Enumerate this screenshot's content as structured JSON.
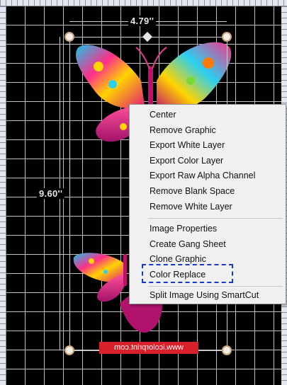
{
  "canvas": {
    "width_label": "4.79''",
    "height_label": "9.60''",
    "watermark": "www.icolorprint.com"
  },
  "context_menu": {
    "group1": [
      {
        "id": "center",
        "label": "Center"
      },
      {
        "id": "remove-graphic",
        "label": "Remove Graphic"
      },
      {
        "id": "export-white-layer",
        "label": "Export White Layer"
      },
      {
        "id": "export-color-layer",
        "label": "Export Color Layer"
      },
      {
        "id": "export-raw-alpha",
        "label": "Export Raw Alpha Channel"
      },
      {
        "id": "remove-blank-space",
        "label": "Remove Blank Space"
      },
      {
        "id": "remove-white-layer",
        "label": "Remove White Layer"
      }
    ],
    "group2": [
      {
        "id": "image-properties",
        "label": "Image Properties"
      },
      {
        "id": "create-gang-sheet",
        "label": "Create Gang Sheet"
      },
      {
        "id": "clone-graphic",
        "label": "Clone Graphic"
      },
      {
        "id": "color-replace",
        "label": "Color Replace"
      }
    ],
    "group3": [
      {
        "id": "split-image-smartcut",
        "label": "Split Image Using SmartCut"
      }
    ]
  },
  "colors": {
    "accent_focus": "#1338d6",
    "watermark_bg": "#d8202a",
    "handle_border": "#c9a47c"
  }
}
